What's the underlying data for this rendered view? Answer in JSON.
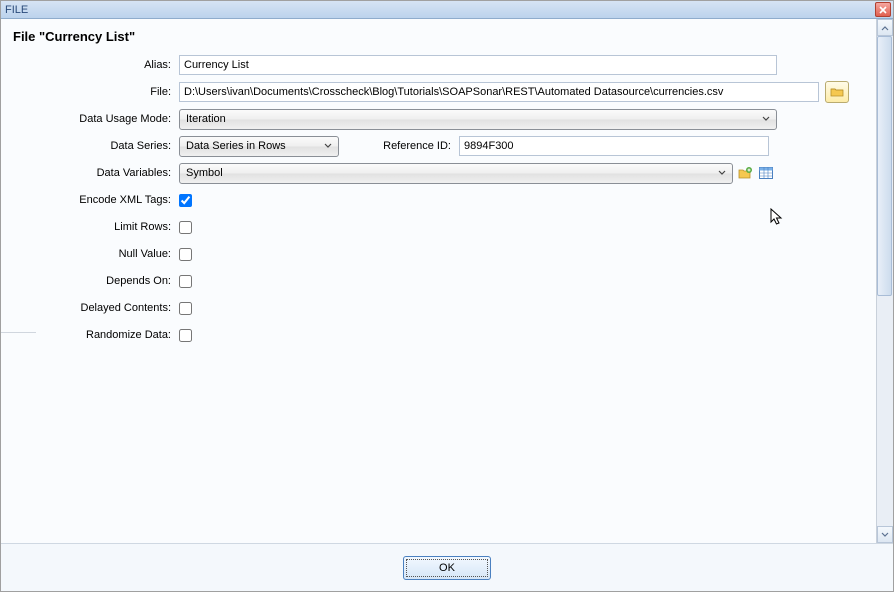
{
  "window": {
    "title": "FILE"
  },
  "heading": {
    "text": "File   \"Currency List\""
  },
  "labels": {
    "alias": "Alias:",
    "file": "File:",
    "data_usage_mode": "Data Usage Mode:",
    "data_series": "Data Series:",
    "reference_id": "Reference ID:",
    "data_variables": "Data Variables:",
    "encode_xml": "Encode XML Tags:",
    "limit_rows": "Limit Rows:",
    "null_value": "Null Value:",
    "depends_on": "Depends On:",
    "delayed_contents": "Delayed Contents:",
    "randomize_data": "Randomize Data:"
  },
  "values": {
    "alias": "Currency List",
    "file": "D:\\Users\\ivan\\Documents\\Crosscheck\\Blog\\Tutorials\\SOAPSonar\\REST\\Automated Datasource\\currencies.csv",
    "data_usage_mode": "Iteration",
    "data_series": "Data Series in Rows",
    "reference_id": "9894F300",
    "data_variables": "Symbol"
  },
  "checkboxes": {
    "encode_xml": true,
    "limit_rows": false,
    "null_value": false,
    "depends_on": false,
    "delayed_contents": false,
    "randomize_data": false
  },
  "footer": {
    "ok": "OK"
  }
}
